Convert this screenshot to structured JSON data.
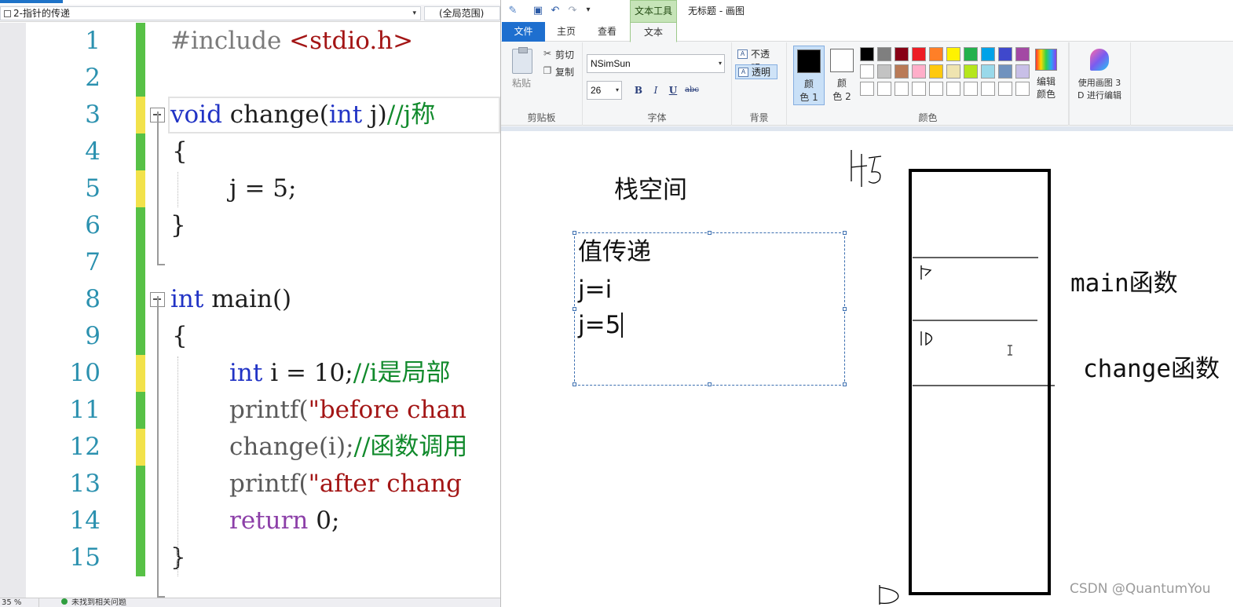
{
  "editor": {
    "file_dropdown": "2-指针的传递",
    "scope_dropdown": "(全局范围)",
    "zoom_value": "35 %",
    "status_issues": "未找到相关问题",
    "lines": [
      {
        "no": "1",
        "state": "saved"
      },
      {
        "no": "2",
        "state": "saved"
      },
      {
        "no": "3",
        "state": "unsaved"
      },
      {
        "no": "4",
        "state": "saved"
      },
      {
        "no": "5",
        "state": "unsaved"
      },
      {
        "no": "6",
        "state": "saved"
      },
      {
        "no": "7",
        "state": "saved"
      },
      {
        "no": "8",
        "state": "saved"
      },
      {
        "no": "9",
        "state": "saved"
      },
      {
        "no": "10",
        "state": "unsaved"
      },
      {
        "no": "11",
        "state": "saved"
      },
      {
        "no": "12",
        "state": "unsaved"
      },
      {
        "no": "13",
        "state": "saved"
      },
      {
        "no": "14",
        "state": "saved"
      },
      {
        "no": "15",
        "state": "saved"
      }
    ],
    "code": {
      "l1_pp": "#include ",
      "l1_inc": "<stdio.h>",
      "l3_kw": "void",
      "l3_rest": " change(",
      "l3_kw2": "int",
      "l3_rest2": " j)",
      "l3_cm": "//j称",
      "l4": "{",
      "l5": "j = 5;",
      "l6": "}",
      "l8_kw": "int",
      "l8_rest": " main()",
      "l9": "{",
      "l10_kw": "int",
      "l10_rest": " i = 10;",
      "l10_cm": "//i是局部",
      "l11_fn": "printf(",
      "l11_str": "\"before chan",
      "l12_fn": "change(i);",
      "l12_cm": "//函数调用",
      "l13_fn": "printf(",
      "l13_str": "\"after chang",
      "l14_kw": "return",
      "l14_rest": " 0;",
      "l15": "}"
    }
  },
  "paint": {
    "title": "无标题 - 画图",
    "context_tab": "文本工具",
    "tabs": {
      "file": "文件",
      "home": "主页",
      "view": "查看",
      "text": "文本"
    },
    "clipboard": {
      "paste": "粘贴",
      "cut": "剪切",
      "copy": "复制",
      "label": "剪贴板"
    },
    "font": {
      "name": "NSimSun",
      "size": "26",
      "bold": "B",
      "italic": "I",
      "underline": "U",
      "strike": "abc",
      "label": "字体"
    },
    "background": {
      "opaque": "不透明",
      "transparent": "透明",
      "label": "背景"
    },
    "colors": {
      "color1_l1": "颜",
      "color1_l2": "色 1",
      "color2_l1": "颜",
      "color2_l2": "色 2",
      "color1_value": "#000000",
      "color2_value": "#ffffff",
      "edit_l1": "编辑",
      "edit_l2": "颜色",
      "label": "颜色",
      "palette_row1": [
        "#000000",
        "#7f7f7f",
        "#880015",
        "#ed1c24",
        "#ff7f27",
        "#fff200",
        "#22b14c",
        "#00a2e8",
        "#3f48cc",
        "#a349a4"
      ],
      "palette_row2": [
        "#ffffff",
        "#c3c3c3",
        "#b97a57",
        "#ffaec9",
        "#ffc90e",
        "#efe4b0",
        "#b5e61d",
        "#99d9ea",
        "#7092be",
        "#c8bfe7"
      ],
      "palette_row3": [
        "#ffffff",
        "#ffffff",
        "#ffffff",
        "#ffffff",
        "#ffffff",
        "#ffffff",
        "#ffffff",
        "#ffffff",
        "#ffffff",
        "#ffffff"
      ]
    },
    "paint3d_l1": "使用画图 3",
    "paint3d_l2": "D 进行编辑",
    "canvas": {
      "stack_title": "栈空间",
      "textbox_lines": [
        "值传递",
        "j=i",
        "j=5"
      ],
      "main_label": "main函数",
      "change_label": "change函数"
    },
    "watermark": "CSDN @QuantumYou"
  }
}
